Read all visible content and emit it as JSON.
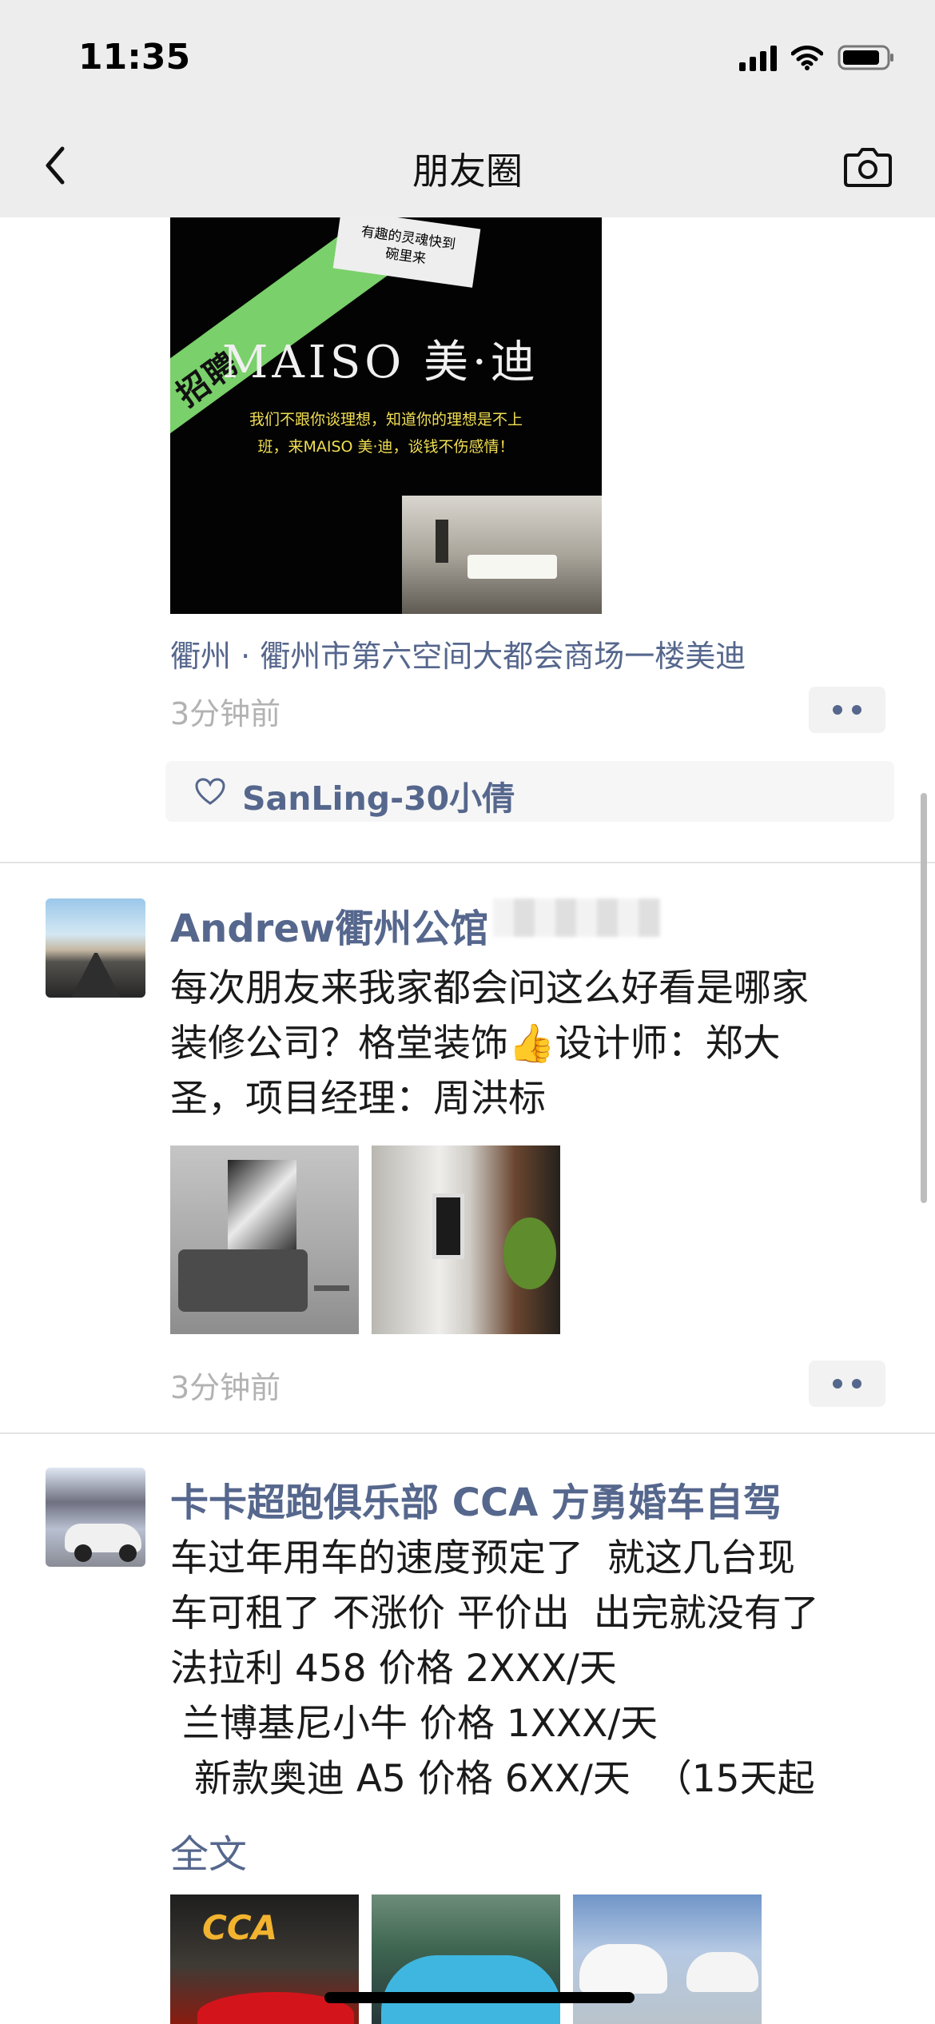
{
  "status_bar": {
    "time": "11:35"
  },
  "nav": {
    "title": "朋友圈",
    "back_icon": "chevron-left-icon",
    "camera_icon": "camera-icon"
  },
  "post1": {
    "image": {
      "ribbon": "招聘",
      "tag": "有趣的灵魂快到\n碗里来",
      "brand": "MAISO 美·迪",
      "slogan": "我们不跟你谈理想，知道你的理想是不上\n班，来MAISO 美·迪，谈钱不伤感情！"
    },
    "location": "衢州 · 衢州市第六空间大都会商场一楼美迪",
    "time": "3分钟前",
    "likes": "SanLing-30小倩"
  },
  "post2": {
    "name": "Andrew衢州公馆",
    "text": "每次朋友来我家都会问这么好看是哪家\n装修公司？格堂装饰👍设计师：郑大\n圣，项目经理：周洪标",
    "time": "3分钟前"
  },
  "post3": {
    "name": "卡卡超跑俱乐部 CCA 方勇婚车自驾",
    "text": "车过年用车的速度预定了  就这几台现\n车可租了 不涨价 平价出  出完就没有了\n法拉利 458 价格 2XXX/天\n 兰博基尼小牛 价格 1XXX/天\n  新款奥迪 A5 价格 6XX/天  （15天起",
    "full_text": "全文",
    "photo_logo": "CCA"
  },
  "colors": {
    "link": "#56678d",
    "timestamp": "#b2b2b2",
    "header_bg": "#ededed"
  }
}
